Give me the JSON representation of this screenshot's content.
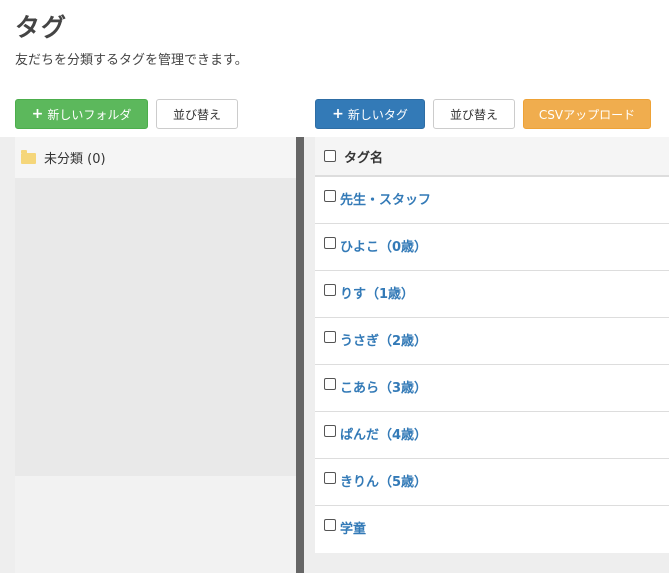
{
  "page": {
    "title": "タグ",
    "description": "友だちを分類するタグを管理できます。"
  },
  "folder_toolbar": {
    "new_folder_label": "新しいフォルダ",
    "sort_label": "並び替え"
  },
  "tag_toolbar": {
    "new_tag_label": "新しいタグ",
    "sort_label": "並び替え",
    "csv_upload_label": "CSVアップロード"
  },
  "folders": [
    {
      "label": "未分類 (0)"
    }
  ],
  "tag_table": {
    "header": "タグ名",
    "tags": [
      "先生・スタッフ",
      "ひよこ（0歳）",
      "りす（1歳）",
      "うさぎ（2歳）",
      "こあら（3歳）",
      "ぱんだ（4歳）",
      "きりん（5歳）",
      "学童"
    ]
  },
  "colors": {
    "green_button": "#5cb85c",
    "blue_button": "#337ab7",
    "orange_button": "#f0ad4e",
    "link": "#337ab7",
    "folder_icon": "#f5d67a"
  },
  "icons": {
    "plus": "plus-icon",
    "folder": "folder-icon"
  }
}
